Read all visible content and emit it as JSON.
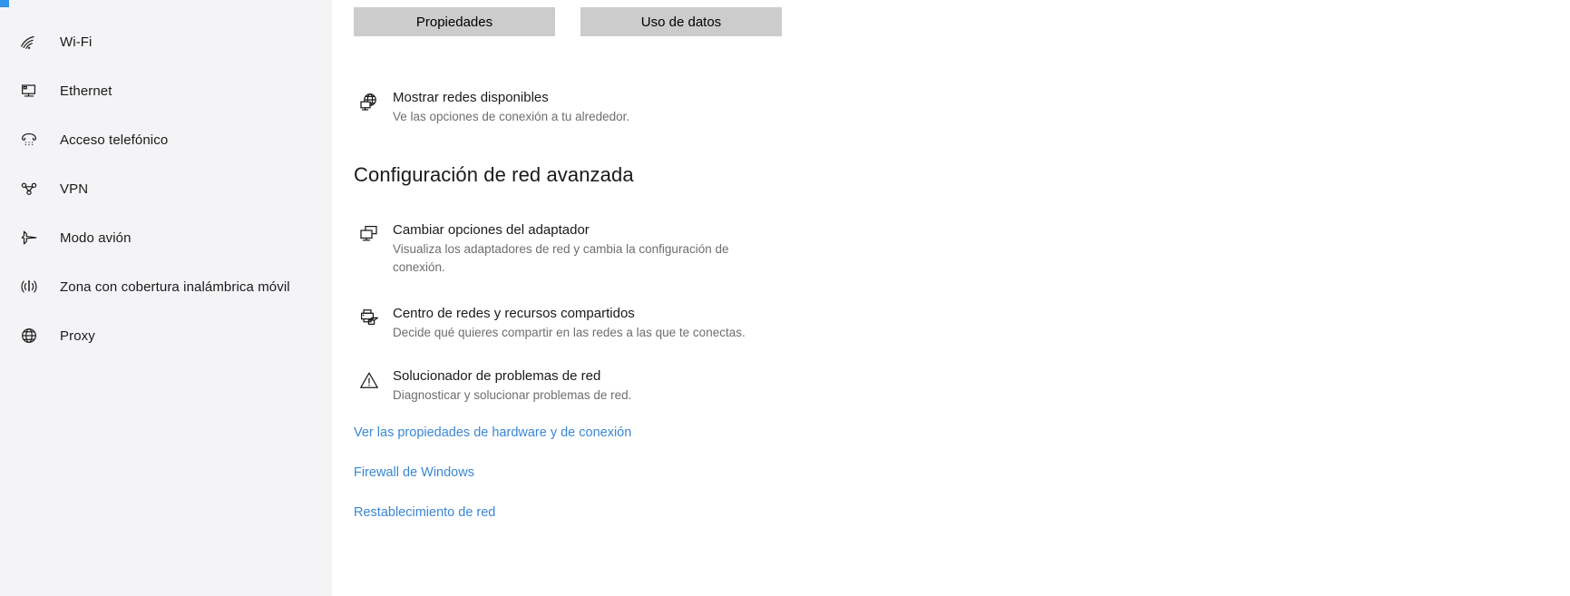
{
  "accent_color": "#3094e8",
  "link_color": "#3a87d3",
  "sidebar": {
    "background": "#f4f4f7",
    "items": [
      {
        "label": "Wi-Fi",
        "icon": "wifi-icon"
      },
      {
        "label": "Ethernet",
        "icon": "ethernet-icon"
      },
      {
        "label": "Acceso telefónico",
        "icon": "dialup-phone-icon"
      },
      {
        "label": "VPN",
        "icon": "vpn-icon"
      },
      {
        "label": "Modo avión",
        "icon": "airplane-icon"
      },
      {
        "label": "Zona con cobertura inalámbrica móvil",
        "icon": "hotspot-icon"
      },
      {
        "label": "Proxy",
        "icon": "globe-icon"
      }
    ]
  },
  "main": {
    "buttons": [
      {
        "label": "Propiedades",
        "name": "properties-button"
      },
      {
        "label": "Uso de datos",
        "name": "data-usage-button"
      }
    ],
    "show_networks": {
      "title": "Mostrar redes disponibles",
      "desc": "Ve las opciones de conexión a tu alrededor.",
      "icon": "network-globe-icon"
    },
    "section_heading": "Configuración de red avanzada",
    "features": [
      {
        "title": "Cambiar opciones del adaptador",
        "desc": "Visualiza los adaptadores de red y cambia la configuración de conexión.",
        "icon": "adapter-monitor-icon"
      },
      {
        "title": "Centro de redes y recursos compartidos",
        "desc": "Decide qué quieres compartir en las redes a las que te conectas.",
        "icon": "sharing-center-icon"
      },
      {
        "title": "Solucionador de problemas de red",
        "desc": "Diagnosticar y solucionar problemas de red.",
        "icon": "warning-triangle-icon"
      }
    ],
    "links": [
      {
        "label": "Ver las propiedades de hardware y de conexión",
        "name": "view-hardware-properties-link"
      },
      {
        "label": "Firewall de Windows",
        "name": "windows-firewall-link"
      },
      {
        "label": "Restablecimiento de red",
        "name": "network-reset-link"
      }
    ]
  }
}
